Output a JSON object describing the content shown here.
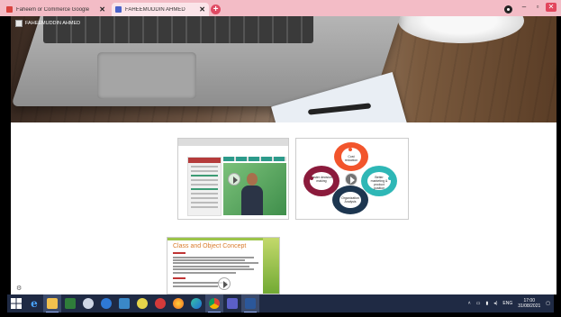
{
  "browser": {
    "tabs": [
      {
        "title": "Faheem or Commerce Google",
        "favicon_color": "#d9433f",
        "active": false
      },
      {
        "title": "FAHEEMUDDIN AHMED",
        "favicon_color": "#4b62c9",
        "active": true
      }
    ],
    "new_tab_label": "+",
    "close_glyph": "✕",
    "window_controls": {
      "minimize": "–",
      "maximize": "▫",
      "close": "✕"
    }
  },
  "page": {
    "user_name": "FAHEEMUDDIN AHMED",
    "slide_title": "Class and Object Concept"
  },
  "diagram": {
    "labels": {
      "top": "Cost reduction",
      "right": "Better marketing & product position",
      "bottom": "Organization Analysis",
      "left": "Faster decision making"
    }
  },
  "taskbar": {
    "language": "ENG",
    "time": "17:00",
    "date": "31/08/2021",
    "icons": [
      "windows-start",
      "edge-legacy",
      "file-explorer",
      "store",
      "unknown-app",
      "vpn",
      "media",
      "winamp",
      "outlook-like",
      "firefox",
      "edge",
      "chrome",
      "teams",
      "word"
    ]
  },
  "colors": {
    "tabstrip": "#f3bcc6",
    "taskbar": "#1f2a44",
    "accent": "#e04a63"
  }
}
